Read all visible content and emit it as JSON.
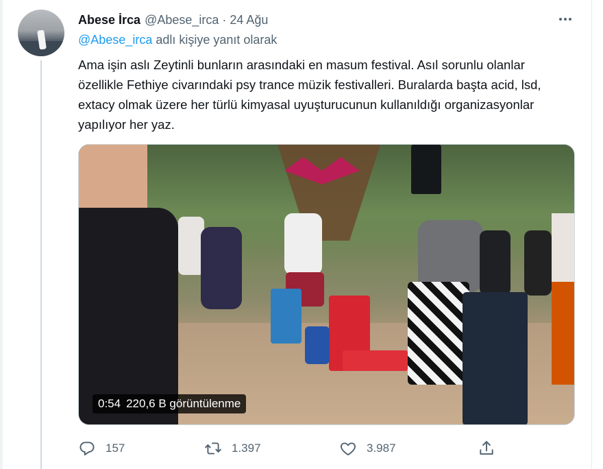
{
  "tweet": {
    "display_name": "Abese İrca",
    "handle": "@Abese_irca",
    "separator": "·",
    "date": "24 Ağu",
    "reply_prefix": "@Abese_irca",
    "reply_suffix": " adlı kişiye yanıt olarak",
    "text": "Ama işin aslı Zeytinli bunların arasındaki en masum festival. Asıl sorunlu olanlar özellikle Fethiye civarındaki psy trance müzik festivalleri. Buralarda başta acid, lsd, extacy olmak üzere her türlü kimyasal uyuşturucunun kullanıldığı organizasyonlar yapılıyor her yaz."
  },
  "video": {
    "duration": "0:54",
    "views": "220,6 B görüntülenme"
  },
  "actions": {
    "replies": "157",
    "retweets": "1.397",
    "likes": "3.987"
  },
  "icons": {
    "more": "more-horizontal-icon",
    "reply": "reply-icon",
    "retweet": "retweet-icon",
    "like": "heart-icon",
    "share": "share-icon"
  },
  "colors": {
    "text_primary": "#0f1419",
    "text_secondary": "#536471",
    "link": "#1d9bf0",
    "thread_line": "#cfd9de"
  }
}
